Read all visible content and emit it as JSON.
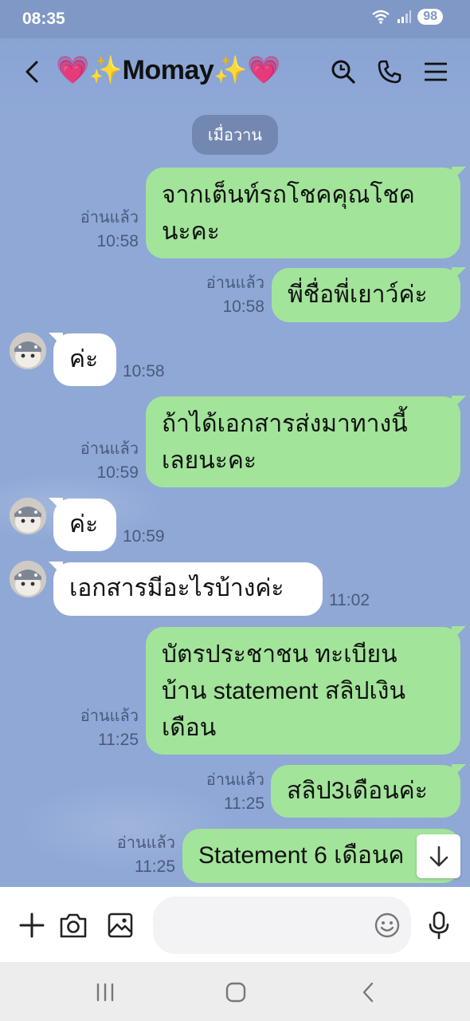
{
  "status": {
    "time": "08:35",
    "battery": "98"
  },
  "header": {
    "title": "💗✨Momay✨💗"
  },
  "chat": {
    "date_label": "เมื่อวาน",
    "messages": [
      {
        "dir": "out",
        "text": "จากเต็นท์รถโชคคุณโชค นะคะ",
        "read": "อ่านแล้ว",
        "time": "10:58"
      },
      {
        "dir": "out",
        "text": "พี่ชื่อพี่เยาว์ค่ะ",
        "read": "อ่านแล้ว",
        "time": "10:58"
      },
      {
        "dir": "in",
        "text": "ค่ะ",
        "time": "10:58"
      },
      {
        "dir": "out",
        "text": "ถ้าได้เอกสารส่งมาทางนี้ เลยนะคะ",
        "read": "อ่านแล้ว",
        "time": "10:59"
      },
      {
        "dir": "in",
        "text": "ค่ะ",
        "time": "10:59"
      },
      {
        "dir": "in",
        "text": "เอกสารมีอะไรบ้างค่ะ",
        "time": "11:02"
      },
      {
        "dir": "out",
        "text": "บัตรประชาชน ทะเบียน บ้าน statement สลิปเงิน เดือน",
        "read": "อ่านแล้ว",
        "time": "11:25"
      },
      {
        "dir": "out",
        "text": "สลิป3เดือนค่ะ",
        "read": "อ่านแล้ว",
        "time": "11:25"
      },
      {
        "dir": "out",
        "text": "Statement 6 เดือนค",
        "read": "อ่านแล้ว",
        "time": "11:25"
      }
    ]
  },
  "colors": {
    "chat_bg": "#8fa8d6",
    "outgoing": "#a2e49a",
    "incoming": "#ffffff"
  },
  "icons": [
    "back-icon",
    "search-icon",
    "phone-icon",
    "menu-icon",
    "plus-icon",
    "camera-icon",
    "image-icon",
    "emoji-icon",
    "mic-icon",
    "arrow-down-icon"
  ]
}
